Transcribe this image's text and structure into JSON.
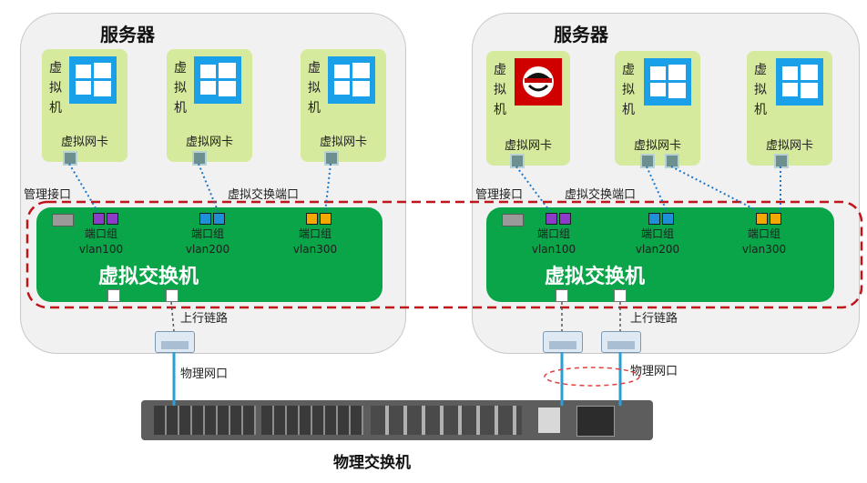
{
  "servers": [
    {
      "title": "服务器",
      "vms": [
        {
          "vertical_label": "虚拟机",
          "nic_label": "虚拟网卡",
          "os_icon": "windows-logo-icon"
        },
        {
          "vertical_label": "虚拟机",
          "nic_label": "虚拟网卡",
          "os_icon": "windows-logo-icon"
        },
        {
          "vertical_label": "虚拟机",
          "nic_label": "虚拟网卡",
          "os_icon": "windows-logo-icon"
        }
      ],
      "mgmt_label": "管理接口",
      "vswitch_port_label": "虚拟交换端口",
      "vswitch_label": "虚拟交换机",
      "port_groups": [
        {
          "label": "端口组",
          "vlan": "vlan100",
          "color": "#8c3cc8"
        },
        {
          "label": "端口组",
          "vlan": "vlan200",
          "color": "#1f8fd8"
        },
        {
          "label": "端口组",
          "vlan": "vlan300",
          "color": "#f4a800"
        }
      ],
      "uplink_label": "上行链路",
      "phys_port_label": "物理网口"
    },
    {
      "title": "服务器",
      "vms": [
        {
          "vertical_label": "虚拟机",
          "nic_label": "虚拟网卡",
          "os_icon": "redhat-logo-icon"
        },
        {
          "vertical_label": "虚拟机",
          "nic_label": "虚拟网卡",
          "os_icon": "windows-logo-icon"
        },
        {
          "vertical_label": "虚拟机",
          "nic_label": "虚拟网卡",
          "os_icon": "windows-logo-icon"
        }
      ],
      "mgmt_label": "管理接口",
      "vswitch_port_label": "虚拟交换端口",
      "vswitch_label": "虚拟交换机",
      "port_groups": [
        {
          "label": "端口组",
          "vlan": "vlan100",
          "color": "#8c3cc8"
        },
        {
          "label": "端口组",
          "vlan": "vlan200",
          "color": "#1f8fd8"
        },
        {
          "label": "端口组",
          "vlan": "vlan300",
          "color": "#f4a800"
        }
      ],
      "uplink_label": "上行链路",
      "phys_port_label": "物理网口"
    }
  ],
  "physical_switch_label": "物理交换机",
  "colors": {
    "vswitch_green": "#0aa449",
    "vm_green": "#d5ea9c",
    "dashed_red": "#c0141b",
    "link_blue": "#2a9fd6",
    "server_bg": "#f1f1f1"
  }
}
